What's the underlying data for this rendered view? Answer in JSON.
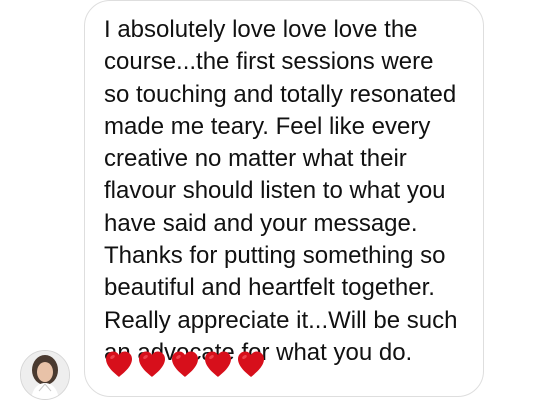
{
  "message": {
    "lines": [
      "I absolutely love love love the",
      "course...the first sessions were",
      "so touching and totally resonated",
      "made me teary. Feel like every",
      "creative no matter what their",
      "flavour should listen to what you",
      "have said and your message.",
      "Thanks for putting something so",
      "beautiful and heartfelt together.",
      "Really appreciate it...Will be such",
      "an advocate for what you do."
    ],
    "reaction_icon": "red-heart-icon",
    "reaction_count": 5
  },
  "colors": {
    "heart": "#d70f1b",
    "bubble_border": "#dedede",
    "text": "#111111"
  }
}
